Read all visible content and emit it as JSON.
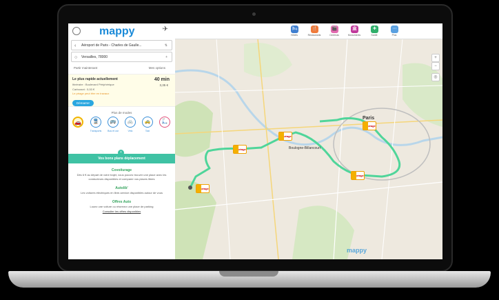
{
  "panel": {
    "logo": "mappy",
    "plane_label": "",
    "from": "Aéroport de Paris - Charles de Gaulle...",
    "to": "Versailles, 78000",
    "option_left": "Partir maintenant",
    "option_right": "Mes options",
    "result": {
      "title": "Le plus rapide actuellement",
      "time": "40 min",
      "cost": "3,35 €",
      "line1": "Itinéraire : Boulevard Périphérique",
      "line2": "Carburant : 5,53 €",
      "alert": "Le péage peut être en travaux",
      "button": "Démarrer"
    },
    "modes_title": "Plus de modes",
    "modes": [
      {
        "icon": "🚗",
        "label": ""
      },
      {
        "icon": "🚆",
        "label": "Transports"
      },
      {
        "icon": "🚌",
        "label": "Bus et car"
      },
      {
        "icon": "🚲",
        "label": "Vélo"
      },
      {
        "icon": "🚕",
        "label": "Taxi"
      },
      {
        "icon": "🛴",
        "label": ""
      }
    ],
    "banner": "Vos bons plans déplacement",
    "sections": [
      {
        "title": "Covoiturage",
        "text": "Dès 6 € au départ de votre trajet, vous pouvez trouver une place avec les conducteurs disponibles et comparer vos places libres",
        "link": ""
      },
      {
        "title": "Autolib'",
        "text": "Les voitures électriques en libre-service disponibles autour de vous",
        "link": ""
      },
      {
        "title": "Offres Auto",
        "text": "Louez une voiture ou réservez une place de parking",
        "link": "Consulter les offres disponibles"
      }
    ]
  },
  "map": {
    "categories": [
      {
        "label": "Hôtels",
        "color": "#3f7fd0",
        "icon": "🛏"
      },
      {
        "label": "Restaurants",
        "color": "#f07a3a",
        "icon": "🍴"
      },
      {
        "label": "Cinémas",
        "color": "#e26bb0",
        "icon": "🎬"
      },
      {
        "label": "Monuments",
        "color": "#c0399b",
        "icon": "🏛"
      },
      {
        "label": "Santé",
        "color": "#2fae6a",
        "icon": "✚"
      },
      {
        "label": "Plus",
        "color": "#5aa0e0",
        "icon": "⋯"
      }
    ],
    "city": "Paris",
    "district": "Boulogne-Billancourt",
    "brand": "mappy",
    "signs": [
      "péage",
      "péage",
      "péage",
      "péage",
      "péage"
    ],
    "route_color": "#4fd59a"
  }
}
